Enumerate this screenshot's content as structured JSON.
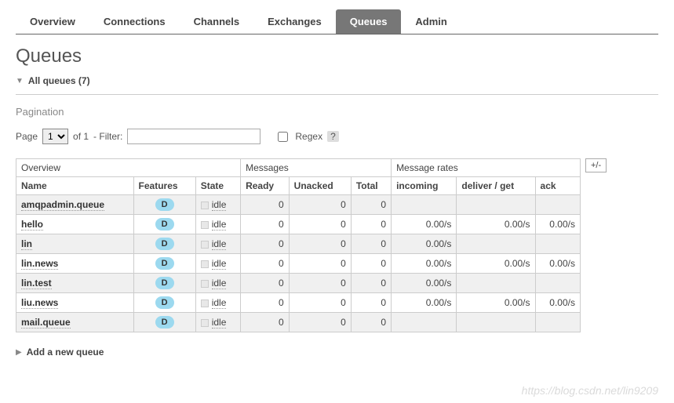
{
  "tabs": {
    "items": [
      {
        "label": "Overview",
        "active": false
      },
      {
        "label": "Connections",
        "active": false
      },
      {
        "label": "Channels",
        "active": false
      },
      {
        "label": "Exchanges",
        "active": false
      },
      {
        "label": "Queues",
        "active": true
      },
      {
        "label": "Admin",
        "active": false
      }
    ]
  },
  "page_title": "Queues",
  "all_queues": {
    "label": "All queues (7)",
    "expanded": true
  },
  "pagination": {
    "heading": "Pagination",
    "page_label": "Page",
    "page_value": "1",
    "of_text": "of 1",
    "filter_label": "- Filter:",
    "filter_value": "",
    "regex_label": "Regex",
    "regex_checked": false,
    "help": "?"
  },
  "table": {
    "group_headers": [
      "Overview",
      "Messages",
      "Message rates"
    ],
    "group_spans": [
      3,
      3,
      3
    ],
    "columns": [
      "Name",
      "Features",
      "State",
      "Ready",
      "Unacked",
      "Total",
      "incoming",
      "deliver / get",
      "ack"
    ],
    "plusminus": "+/-",
    "rows": [
      {
        "name": "amqpadmin.queue",
        "feature": "D",
        "state": "idle",
        "ready": "0",
        "unacked": "0",
        "total": "0",
        "incoming": "",
        "deliver": "",
        "ack": ""
      },
      {
        "name": "hello",
        "feature": "D",
        "state": "idle",
        "ready": "0",
        "unacked": "0",
        "total": "0",
        "incoming": "0.00/s",
        "deliver": "0.00/s",
        "ack": "0.00/s"
      },
      {
        "name": "lin",
        "feature": "D",
        "state": "idle",
        "ready": "0",
        "unacked": "0",
        "total": "0",
        "incoming": "0.00/s",
        "deliver": "",
        "ack": ""
      },
      {
        "name": "lin.news",
        "feature": "D",
        "state": "idle",
        "ready": "0",
        "unacked": "0",
        "total": "0",
        "incoming": "0.00/s",
        "deliver": "0.00/s",
        "ack": "0.00/s"
      },
      {
        "name": "lin.test",
        "feature": "D",
        "state": "idle",
        "ready": "0",
        "unacked": "0",
        "total": "0",
        "incoming": "0.00/s",
        "deliver": "",
        "ack": ""
      },
      {
        "name": "liu.news",
        "feature": "D",
        "state": "idle",
        "ready": "0",
        "unacked": "0",
        "total": "0",
        "incoming": "0.00/s",
        "deliver": "0.00/s",
        "ack": "0.00/s"
      },
      {
        "name": "mail.queue",
        "feature": "D",
        "state": "idle",
        "ready": "0",
        "unacked": "0",
        "total": "0",
        "incoming": "",
        "deliver": "",
        "ack": ""
      }
    ]
  },
  "add_queue": {
    "label": "Add a new queue",
    "expanded": false
  },
  "watermark": "https://blog.csdn.net/lin9209"
}
